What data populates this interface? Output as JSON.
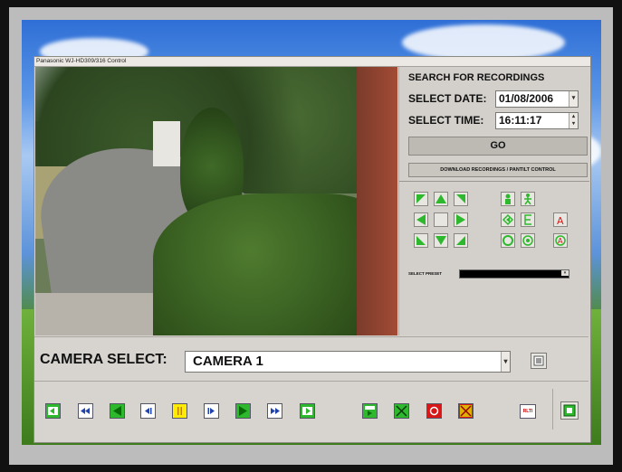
{
  "window": {
    "title": "Panasonic WJ-HD309/316 Control"
  },
  "search": {
    "heading": "SEARCH FOR RECORDINGS",
    "date_label": "SELECT DATE:",
    "date_value": "01/08/2006",
    "time_label": "SELECT TIME:",
    "time_value": "16:11:17",
    "go_label": "GO",
    "download_label": "DOWNLOAD RECORDINGS / PANTILT CONTROL"
  },
  "ptz": {
    "preset_label": "SELECT PRESET",
    "preset_value": "",
    "icons": [
      "pan-up-left-icon",
      "pan-up-icon",
      "pan-up-right-icon",
      "pan-left-icon",
      "pan-home-icon",
      "pan-right-icon",
      "pan-down-left-icon",
      "pan-down-icon",
      "pan-down-right-icon",
      "zoom-tele-icon",
      "zoom-wide-icon",
      "focus-near-icon",
      "focus-far-icon",
      "auto-focus-icon",
      "iris-open-icon",
      "iris-close-icon",
      "auto-iris-icon"
    ]
  },
  "camera": {
    "select_label": "CAMERA SELECT:",
    "selected": "CAMERA 1"
  },
  "controls": {
    "icons": [
      "skip-to-start-icon",
      "fast-rewind-icon",
      "reverse-play-icon",
      "step-back-icon",
      "pause-icon",
      "step-forward-icon",
      "play-icon",
      "fast-forward-icon",
      "skip-to-end-icon",
      "record-search-icon",
      "stop-icon",
      "record-icon",
      "cancel-icon",
      "realtime-icon",
      "exit-icon"
    ],
    "realtime_label": "RLTI"
  },
  "colors": {
    "panel": "#d7d4cf",
    "green": "#2db82d",
    "yellow": "#ffec00",
    "red": "#d81818"
  }
}
